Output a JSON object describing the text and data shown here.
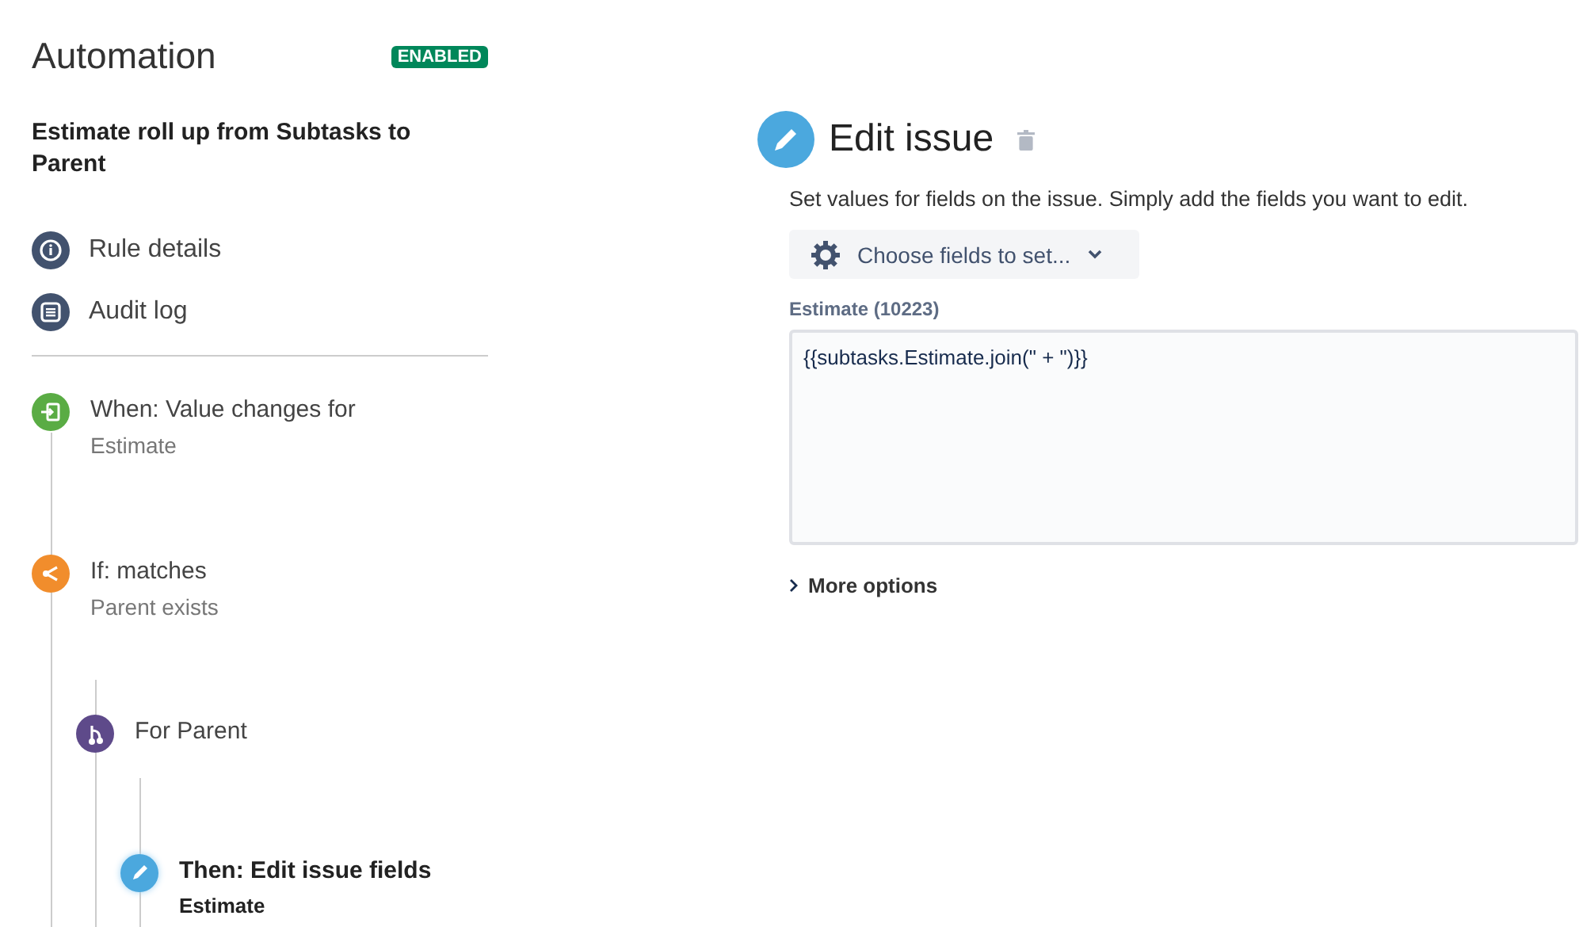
{
  "sidebar": {
    "title": "Automation",
    "status_badge": "ENABLED",
    "rule_name": "Estimate roll up from Subtasks to Parent",
    "links": [
      {
        "label": "Rule details",
        "kind": "info"
      },
      {
        "label": "Audit log",
        "kind": "log"
      }
    ],
    "steps": [
      {
        "kind": "trigger",
        "title": "When: Value changes for",
        "subtitle": "Estimate",
        "selected": false
      },
      {
        "kind": "condition",
        "title": "If: matches",
        "subtitle": "Parent exists",
        "selected": false,
        "children": [
          {
            "kind": "branch",
            "title": "For Parent",
            "selected": false,
            "children": [
              {
                "kind": "action",
                "title": "Then: Edit issue fields",
                "subtitle": "Estimate",
                "selected": true
              }
            ]
          }
        ]
      }
    ]
  },
  "editor": {
    "title": "Edit issue",
    "description": "Set values for fields on the issue. Simply add the fields you want to edit.",
    "choose_button": "Choose fields to set...",
    "field": {
      "label": "Estimate (10223)",
      "value": "{{subtasks.Estimate.join(\" + \")}}"
    },
    "more_options": "More options"
  }
}
